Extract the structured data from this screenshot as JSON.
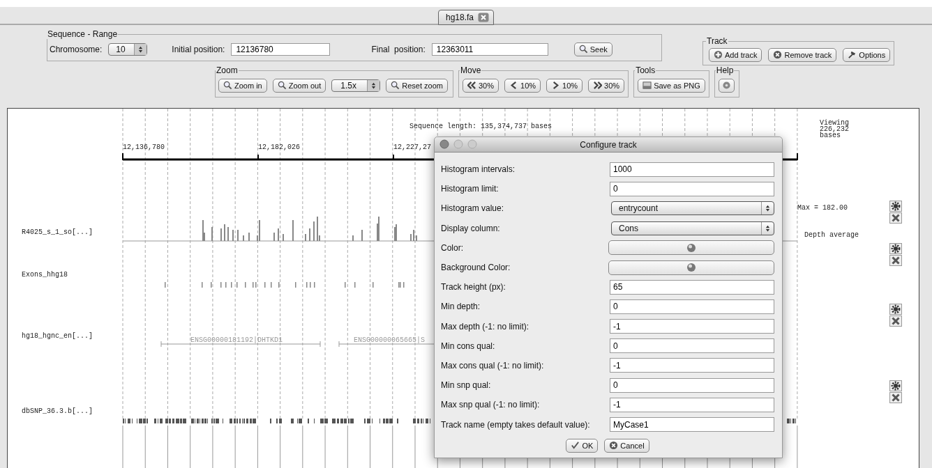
{
  "tab": {
    "label": "hg18.fa"
  },
  "sequence_range": {
    "title": "Sequence - Range",
    "chromosome_label": "Chromosome:",
    "chromosome": "10",
    "initial_label": "Initial position:",
    "initial": "12136780",
    "final_label": "Final  position:",
    "final": "12363011",
    "seek": "Seek"
  },
  "track": {
    "title": "Track",
    "buttons": [
      {
        "label": "Add track"
      },
      {
        "label": "Remove track"
      },
      {
        "label": "Options"
      }
    ]
  },
  "zoom": {
    "title": "Zoom",
    "zoom_in": "Zoom in",
    "zoom_out": "Zoom out",
    "factor": "1.5x",
    "reset": "Reset zoom"
  },
  "move": {
    "title": "Move",
    "buttons": [
      {
        "label": "30%"
      },
      {
        "label": "10%"
      },
      {
        "label": "10%"
      },
      {
        "label": "30%"
      }
    ]
  },
  "tools": {
    "title": "Tools",
    "save": "Save as PNG"
  },
  "help": {
    "title": "Help"
  },
  "view": {
    "sequence_length": "Sequence length: 135,374,737 bases",
    "viewing": [
      "Viewing",
      "226,232",
      "bases"
    ],
    "ruler_labels": [
      "12,136,780",
      "12,182,026",
      "12,227,27"
    ],
    "tracks": [
      {
        "name": "R4025_s_1_so[...]",
        "kind": "histogram",
        "max": "Max = 182.00",
        "caption": "Depth average"
      },
      {
        "name": "Exons_hhg18",
        "kind": "exons"
      },
      {
        "name": "hg18_hgnc_en[...]",
        "kind": "genes",
        "genes": [
          "ENSG00000181192|DHTKD1",
          "ENSG00000065665|S"
        ]
      },
      {
        "name": "dbSNP_36.3.b[...]",
        "kind": "snp"
      }
    ]
  },
  "dialog": {
    "title": "Configure track",
    "fields": [
      {
        "label": "Histogram intervals:",
        "kind": "text",
        "value": "1000"
      },
      {
        "label": "Histogram limit:",
        "kind": "text",
        "value": "0"
      },
      {
        "label": "Histogram value:",
        "kind": "select",
        "value": "entrycount"
      },
      {
        "label": "Display column:",
        "kind": "select",
        "value": "Cons"
      },
      {
        "label": "Color:",
        "kind": "color"
      },
      {
        "label": "Background Color:",
        "kind": "color"
      },
      {
        "label": "Track height (px):",
        "kind": "text",
        "value": "65"
      },
      {
        "label": "Min depth:",
        "kind": "text",
        "value": "0"
      },
      {
        "label": "Max depth (-1: no limit):",
        "kind": "text",
        "value": "-1"
      },
      {
        "label": "Min cons qual:",
        "kind": "text",
        "value": "0"
      },
      {
        "label": "Max cons qual (-1: no limit):",
        "kind": "text",
        "value": "-1"
      },
      {
        "label": "Min snp qual:",
        "kind": "text",
        "value": "0"
      },
      {
        "label": "Max snp qual (-1: no limit):",
        "kind": "text",
        "value": "-1"
      },
      {
        "label": "Track name (empty takes default value):",
        "kind": "text",
        "value": "MyCase1"
      }
    ],
    "ok": "OK",
    "cancel": "Cancel"
  }
}
